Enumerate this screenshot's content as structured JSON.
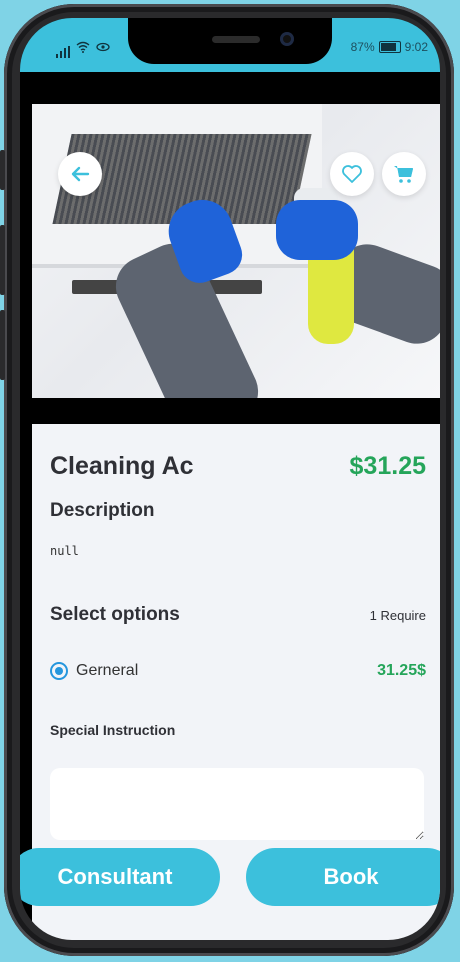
{
  "status_bar": {
    "battery_text": "87%",
    "time": "9:02"
  },
  "colors": {
    "accent": "#3cc0dc",
    "price_green": "#25a55a",
    "radio_blue": "#2496dd"
  },
  "hero": {
    "back_icon": "arrow-left-icon",
    "favorite_icon": "heart-icon",
    "cart_icon": "cart-icon"
  },
  "product": {
    "title": "Cleaning Ac",
    "price": "$31.25",
    "description_label": "Description",
    "description_text": "null"
  },
  "options": {
    "label": "Select options",
    "require_text": "1 Require",
    "items": [
      {
        "label": "Gerneral",
        "price": "31.25$",
        "selected": true
      }
    ]
  },
  "instruction": {
    "label": "Special Instruction",
    "value": "",
    "placeholder": ""
  },
  "actions": {
    "consultant_label": "Consultant",
    "book_label": "Book"
  }
}
